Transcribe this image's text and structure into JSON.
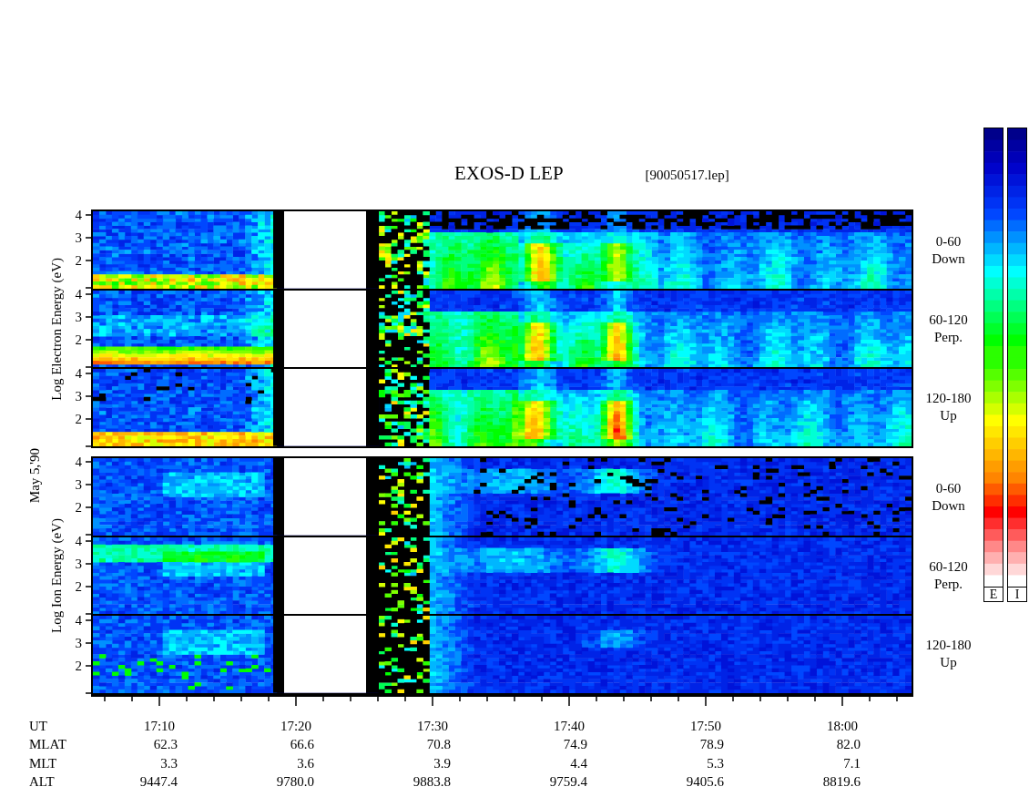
{
  "title": "EXOS-D LEP",
  "file": "[90050517.lep]",
  "date": "May 5,'90",
  "groups": [
    {
      "axis_label": "Log Electron Energy (eV)",
      "panels": [
        {
          "kind": "electron",
          "ticks": [
            "4",
            "3",
            "2"
          ],
          "pitch_angle": "0-60",
          "direction": "Down"
        },
        {
          "kind": "electron",
          "ticks": [
            "4",
            "3",
            "2"
          ],
          "pitch_angle": "60-120",
          "direction": "Perp."
        },
        {
          "kind": "electron",
          "ticks": [
            "4",
            "3",
            "2"
          ],
          "pitch_angle": "120-180",
          "direction": "Up"
        }
      ]
    },
    {
      "axis_label": "Log Ion Energy (eV)",
      "panels": [
        {
          "kind": "ion",
          "ticks": [
            "4",
            "3",
            "2"
          ],
          "pitch_angle": "0-60",
          "direction": "Down"
        },
        {
          "kind": "ion",
          "ticks": [
            "4",
            "3",
            "2"
          ],
          "pitch_angle": "60-120",
          "direction": "Perp."
        },
        {
          "kind": "ion",
          "ticks": [
            "4",
            "3",
            "2"
          ],
          "pitch_angle": "120-180",
          "direction": "Up"
        }
      ]
    }
  ],
  "color_scales": [
    {
      "label": "E"
    },
    {
      "label": "I"
    }
  ],
  "x_axis": {
    "rows": [
      {
        "label": "UT",
        "kind": "time",
        "values": [
          "17:10",
          "17:20",
          "17:30",
          "17:40",
          "17:50",
          "18:00"
        ]
      },
      {
        "label": "MLAT",
        "kind": "value",
        "values": [
          "62.3",
          "66.6",
          "70.8",
          "74.9",
          "78.9",
          "82.0"
        ]
      },
      {
        "label": "MLT",
        "kind": "value",
        "values": [
          "3.3",
          "3.6",
          "3.9",
          "4.4",
          "5.3",
          "7.1"
        ]
      },
      {
        "label": "ALT",
        "kind": "value",
        "values": [
          "9447.4",
          "9780.0",
          "9883.8",
          "9759.4",
          "9405.6",
          "8819.6"
        ]
      }
    ]
  }
}
